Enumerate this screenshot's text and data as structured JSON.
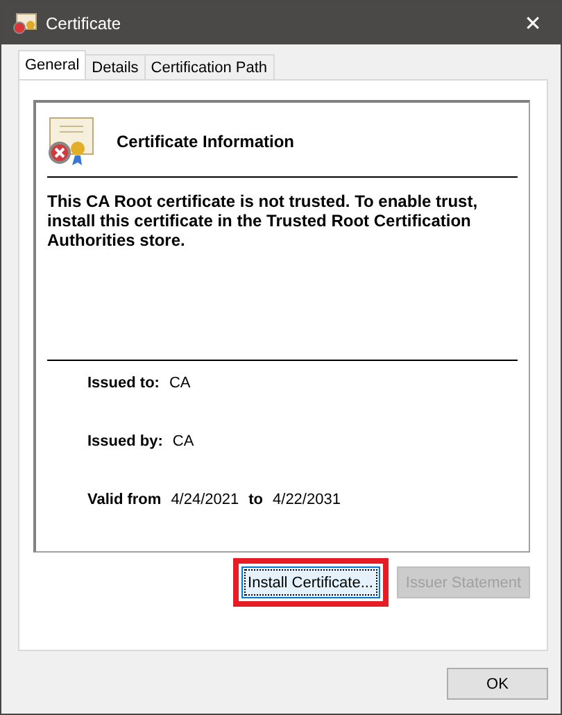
{
  "window": {
    "title": "Certificate",
    "close": "✕"
  },
  "tabs": [
    {
      "label": "General",
      "selected": true
    },
    {
      "label": "Details",
      "selected": false
    },
    {
      "label": "Certification Path",
      "selected": false
    }
  ],
  "info": {
    "heading": "Certificate Information",
    "message": "This CA Root certificate is not trusted. To enable trust, install this certificate in the Trusted Root Certification Authorities store.",
    "issued_to": {
      "label": "Issued to:",
      "value": "CA"
    },
    "issued_by": {
      "label": "Issued by:",
      "value": "CA"
    },
    "validity": {
      "from_label": "Valid from",
      "from": "4/24/2021",
      "to_label": "to",
      "to": "4/22/2031"
    }
  },
  "buttons": [
    {
      "label": "Install Certificate...",
      "disabled": false,
      "highlighted": true
    },
    {
      "label": "Issuer Statement",
      "disabled": true,
      "highlighted": false
    }
  ],
  "footer_button": "OK"
}
